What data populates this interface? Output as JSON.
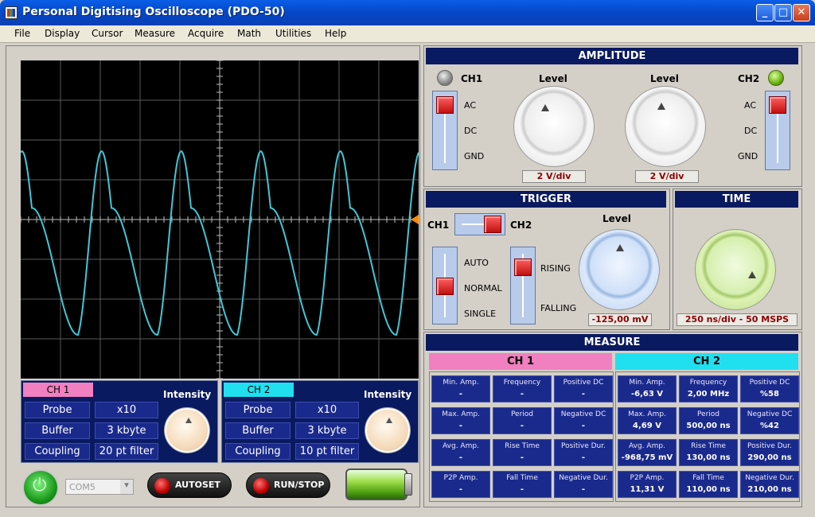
{
  "window": {
    "title": "Personal Digitising Oscilloscope (PDO-50)",
    "minimize": "_",
    "maximize": "□",
    "close": "✕"
  },
  "menu": [
    "File",
    "Display",
    "Cursor",
    "Measure",
    "Acquire",
    "Math",
    "Utilities",
    "Help"
  ],
  "colors": {
    "trace": "#40c8d8",
    "ch1_tag": "#f080c0",
    "ch2_tag": "#20e0f0",
    "panel_header": "#0a1a60",
    "cell_bg": "#1a2a8c",
    "value_text": "#8b0000",
    "trigger_marker": "#ff8800"
  },
  "scope": {
    "waveform": "ch2-signal",
    "trigger_marker": "trigger-level-marker"
  },
  "ch1_settings": {
    "tag": "CH 1",
    "intensity_label": "Intensity",
    "rows": [
      {
        "label": "Probe",
        "value": "x10"
      },
      {
        "label": "Buffer",
        "value": "3 kbyte"
      },
      {
        "label": "Coupling",
        "value": "20 pt filter"
      }
    ]
  },
  "ch2_settings": {
    "tag": "CH 2",
    "intensity_label": "Intensity",
    "rows": [
      {
        "label": "Probe",
        "value": "x10"
      },
      {
        "label": "Buffer",
        "value": "3 kbyte"
      },
      {
        "label": "Coupling",
        "value": "10 pt filter"
      }
    ]
  },
  "controls": {
    "com_port": "COM5",
    "autoset": "AUTOSET",
    "runstop": "RUN/STOP"
  },
  "amplitude": {
    "title": "AMPLITUDE",
    "ch1_label": "CH1",
    "ch2_label": "CH2",
    "level_label": "Level",
    "coupling": [
      "AC",
      "DC",
      "GND"
    ],
    "ch1_value": "2 V/div",
    "ch2_value": "2 V/div"
  },
  "trigger": {
    "title": "TRIGGER",
    "ch1": "CH1",
    "ch2": "CH2",
    "modes": [
      "AUTO",
      "NORMAL",
      "SINGLE"
    ],
    "edges": [
      "RISING",
      "FALLING"
    ],
    "level_label": "Level",
    "level_value": "-125,00 mV"
  },
  "time": {
    "title": "TIME",
    "value": "250 ns/div - 50 MSPS"
  },
  "measure": {
    "title": "MEASURE",
    "ch1": {
      "header": "CH 1",
      "cells": [
        {
          "label": "Min. Amp.",
          "value": "-"
        },
        {
          "label": "Frequency",
          "value": "-"
        },
        {
          "label": "Positive DC",
          "value": "-"
        },
        {
          "label": "Max. Amp.",
          "value": "-"
        },
        {
          "label": "Period",
          "value": "-"
        },
        {
          "label": "Negative DC",
          "value": "-"
        },
        {
          "label": "Avg. Amp.",
          "value": "-"
        },
        {
          "label": "Rise Time",
          "value": "-"
        },
        {
          "label": "Positive Dur.",
          "value": "-"
        },
        {
          "label": "P2P Amp.",
          "value": "-"
        },
        {
          "label": "Fall Time",
          "value": "-"
        },
        {
          "label": "Negative Dur.",
          "value": "-"
        }
      ]
    },
    "ch2": {
      "header": "CH 2",
      "cells": [
        {
          "label": "Min. Amp.",
          "value": "-6,63 V"
        },
        {
          "label": "Frequency",
          "value": "2,00 MHz"
        },
        {
          "label": "Positive DC",
          "value": "%58"
        },
        {
          "label": "Max. Amp.",
          "value": "4,69 V"
        },
        {
          "label": "Period",
          "value": "500,00 ns"
        },
        {
          "label": "Negative DC",
          "value": "%42"
        },
        {
          "label": "Avg. Amp.",
          "value": "-968,75 mV"
        },
        {
          "label": "Rise Time",
          "value": "130,00 ns"
        },
        {
          "label": "Positive Dur.",
          "value": "290,00 ns"
        },
        {
          "label": "P2P Amp.",
          "value": "11,31 V"
        },
        {
          "label": "Fall Time",
          "value": "110,00 ns"
        },
        {
          "label": "Negative Dur.",
          "value": "210,00 ns"
        }
      ]
    }
  }
}
